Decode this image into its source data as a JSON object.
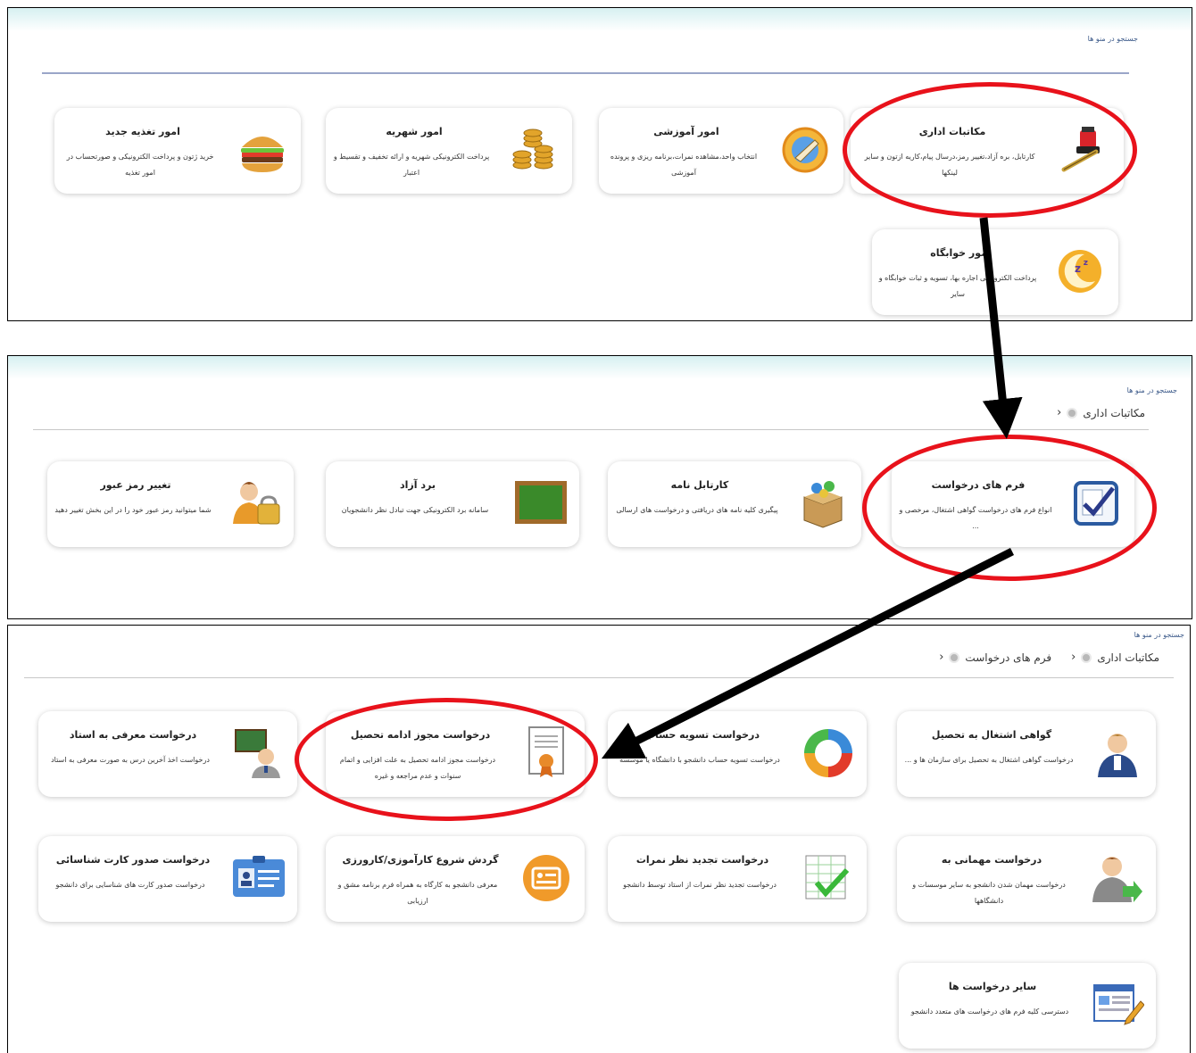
{
  "panel1": {
    "search": "جستجو در منو ها",
    "cards": [
      {
        "title": "مکاتبات اداری",
        "desc": "کارتابل، بره آزاد،تغییر رمز،درسال پیام،کاریه ازتون و سایر لینکها",
        "icon": "pen-inkwell-icon"
      },
      {
        "title": "امور آموزشی",
        "desc": "انتخاب واحد،مشاهده نمرات،برنامه ریزی و پرونده آموزشی",
        "icon": "education-globe-icon"
      },
      {
        "title": "امور شهریه",
        "desc": "پرداخت الکترونیکی شهریه و ارائه تخفیف و تقسیط و اعتبار",
        "icon": "coins-stack-icon"
      },
      {
        "title": "امور تغذیه جدید",
        "desc": "خرید ژتون و پرداخت الکترونیکی و صورتحساب در امور تغذیه",
        "icon": "burger-icon"
      },
      {
        "title": "امور خوابگاه",
        "desc": "پرداخت الکترونیکی اجاره بها، تسویه و ثبات خوابگاه و سایر",
        "icon": "moon-sleep-icon"
      }
    ]
  },
  "panel2": {
    "search": "جستجو در منو ها",
    "breadcrumb": [
      "مکاتبات اداری"
    ],
    "cards": [
      {
        "title": "فرم های درخواست",
        "desc": "انواع فرم های درخواست گواهی اشتغال، مرخصی و ...",
        "icon": "form-check-icon"
      },
      {
        "title": "کارتابل نامه",
        "desc": "پیگیری کلیه نامه های دریافتی و درخواست های ارسالی",
        "icon": "box-icon"
      },
      {
        "title": "برد آزاد",
        "desc": "سامانه برد الکترونیکی جهت تبادل نظر دانشجویان",
        "icon": "chalkboard-icon"
      },
      {
        "title": "تغییر رمز عبور",
        "desc": "شما میتوانید رمز عبور خود را در این بخش تغییر دهید",
        "icon": "user-lock-icon"
      }
    ]
  },
  "panel3": {
    "search": "جستجو در منو ها",
    "breadcrumb": [
      "مکاتبات اداری",
      "فرم های درخواست"
    ],
    "cards": [
      {
        "title": "گواهی اشتغال به تحصیل",
        "desc": "درخواست گواهی اشتغال به تحصیل برای سازمان ها و ...",
        "icon": "student-user-icon"
      },
      {
        "title": "درخواست تسویه حساب",
        "desc": "درخواست تسویه حساب دانشجو با دانشگاه یا موسسه",
        "icon": "refresh-arrows-icon"
      },
      {
        "title": "درخواست مجوز ادامه تحصیل",
        "desc": "درخواست مجوز ادامه تحصیل به علت افزایی و اتمام سنوات و عدم مراجعه و غیره",
        "icon": "certificate-icon"
      },
      {
        "title": "درخواست معرفی به استاد",
        "desc": "درخواست اخذ آخرین درس به صورت معرفی به استاد",
        "icon": "teacher-board-icon"
      },
      {
        "title": "درخواست مهمانی به",
        "desc": "درخواست مهمان شدن دانشجو به سایر موسسات و دانشگاهها",
        "icon": "user-arrow-icon"
      },
      {
        "title": "درخواست تجدید نظر نمرات",
        "desc": "درخواست تجدید نظر نمرات از استاد توسط دانشجو",
        "icon": "grade-check-icon"
      },
      {
        "title": "گردش شروع کارآموزی/کارورزی",
        "desc": "معرفی دانشجو به کارگاه به همراه فرم برنامه مشق و ارزیابی",
        "icon": "internship-icon"
      },
      {
        "title": "درخواست صدور کارت شناسائی",
        "desc": "درخواست صدور کارت های شناسایی برای دانشجو",
        "icon": "id-card-icon"
      },
      {
        "title": "سایر درخواست ها",
        "desc": "دسترسی کلیه فرم های درخواست های متعدد دانشجو",
        "icon": "document-edit-icon"
      }
    ]
  },
  "colors": {
    "highlight": "#e8121b",
    "arrow": "#000000",
    "accent": "#9aa6c8"
  }
}
